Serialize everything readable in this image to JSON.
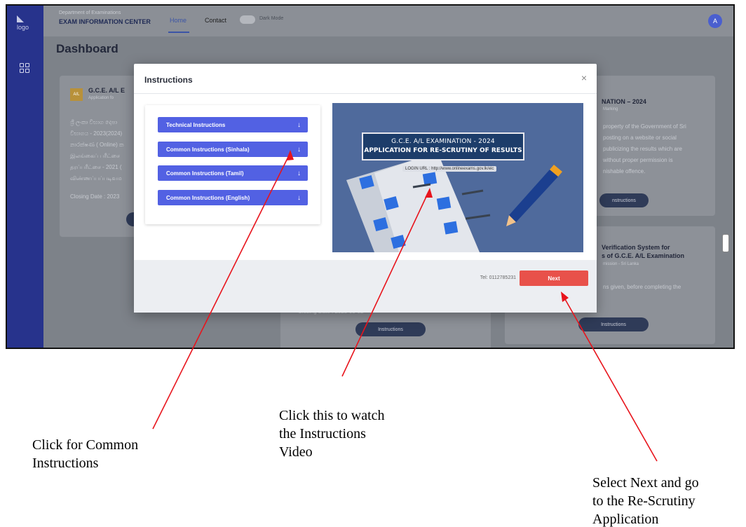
{
  "app": {
    "logo_alt": "logo",
    "department": "Department of Examinations",
    "center_title": "EXAM INFORMATION CENTER",
    "nav": {
      "home": "Home",
      "contact": "Contact",
      "dark_mode": "Dark Mode"
    },
    "avatar_letter": "A"
  },
  "dashboard": {
    "title": "Dashboard",
    "card_a": {
      "badge": "A/L",
      "title": "G.C.E. A/L E",
      "subtitle": "Application fo",
      "lines": [
        "ශ්‍රී ලංකා විභාග දෙපා",
        "විභාගය - 2023(2024)",
        "නාරක්ෂණ ( Online) ක",
        "இலங்கைப் பரீட்சை",
        "தரப்பரீட்சை - 2021 (",
        "விண்ணப்பப்படிவம"
      ],
      "closing": "Closing Date : 2023"
    },
    "card_b": {
      "title": "NATION – 2024",
      "subtitle": "Marking",
      "lines": [
        "property of the Government of Sri",
        "posting on a website or social",
        "publicizing the results which are",
        "without proper permission is",
        "nishable offence."
      ],
      "button": "nstructions"
    },
    "card_c": {
      "title_1": "Verification System for",
      "title_2": "s of G.C.E. A/L Examination",
      "subtitle": "mission - Sri Lanka",
      "line": "ns given, before completing the",
      "button": "Instructions"
    },
    "card_d": {
      "closing": "Closing Date : 2025-05-02",
      "button": "Instructions"
    }
  },
  "modal": {
    "title": "Instructions",
    "close": "×",
    "buttons": [
      "Technical Instructions",
      "Common Instructions (Sinhala)",
      "Common Instructions (Tamil)",
      "Common Instructions (English)"
    ],
    "arrow": "↓",
    "video": {
      "line1": "G.C.E. A/L EXAMINATION - 2024",
      "line2": "APPLICATION FOR RE-SCRUTINY OF RESULTS",
      "url": "LOGIN URL : http://www.onlineexams.gov.lk/eic"
    },
    "tel": "Tel: 0112785231",
    "next": "Next"
  },
  "annotations": {
    "left": [
      "Click for Common",
      "Instructions"
    ],
    "middle": [
      "Click this to watch",
      "the Instructions",
      "Video"
    ],
    "right": [
      "Select Next and go",
      "to the Re-Scrutiny",
      "Application"
    ],
    "arrow_color": "#e8141c"
  },
  "colors": {
    "sidebar": "#27338c",
    "instr_button": "#5261e3",
    "next_button": "#e8514a"
  }
}
